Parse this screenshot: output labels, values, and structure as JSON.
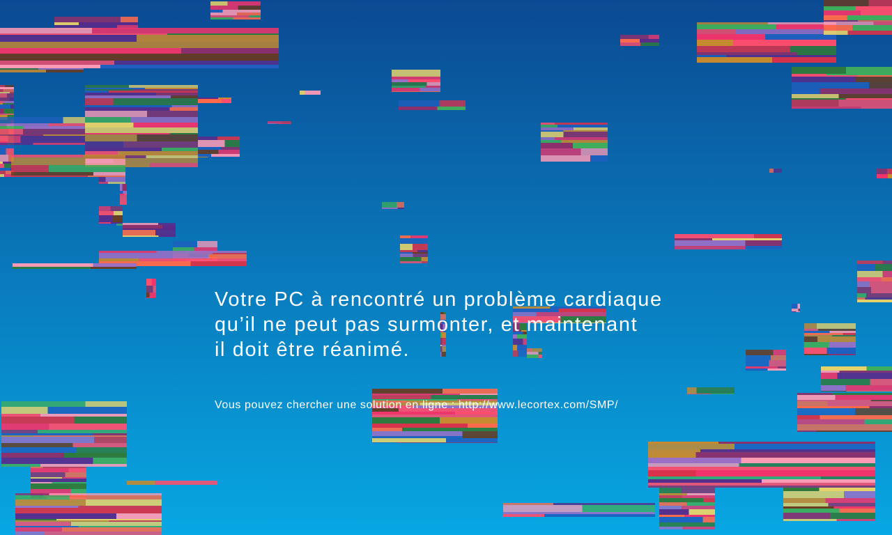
{
  "screen": {
    "background": {
      "top_color": "#0b4a92",
      "bottom_color": "#07a7e3"
    },
    "glitch_palette": [
      "#ff4d6d",
      "#f0346b",
      "#ff6a4a",
      "#8c2f6b",
      "#5a2a8a",
      "#2f7a3a",
      "#c98a2e",
      "#e8d36a",
      "#9b6fc7",
      "#ff9bb5",
      "#1e5fbf",
      "#d9324a",
      "#6b3a1e",
      "#3fae5c"
    ],
    "message": {
      "headline_lines": [
        "Votre PC à rencontré un problème cardiaque",
        "qu’il ne peut pas surmonter, et maintenant",
        "il doit être réanimé."
      ],
      "help_prefix": "Vous pouvez chercher une solution en ligne : ",
      "help_link": "http://www.lecortex.com/SMP/"
    }
  }
}
